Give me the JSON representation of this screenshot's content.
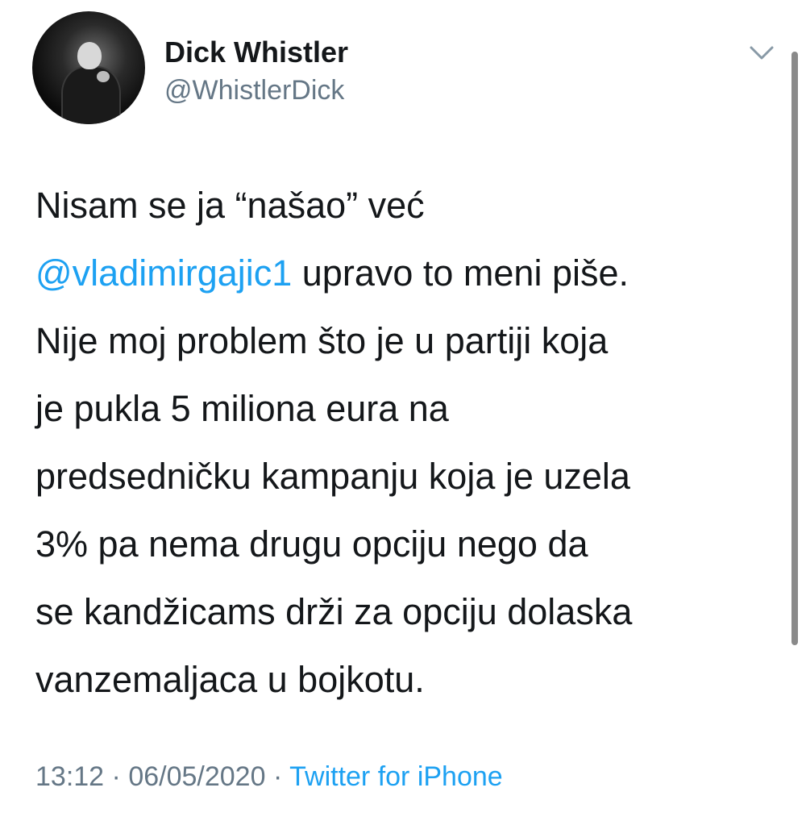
{
  "author": {
    "display_name": "Dick Whistler",
    "handle": "@WhistlerDick"
  },
  "icons": {
    "avatar": "profile-photo",
    "menu": "chevron-down-icon"
  },
  "tweet": {
    "line1": "Nisam se ja “našao” već",
    "mention": "@vladimirgajic1",
    "line2_rest": " upravo to meni piše.",
    "line3": "Nije moj problem što je u partiji koja",
    "line4": "je pukla 5 miliona eura na",
    "line5": "predsedničku kampanju koja je uzela",
    "line6": "3% pa nema drugu opciju nego da",
    "line7": "se kandžicams drži za opciju dolaska",
    "line8": "vanzemaljaca u bojkotu."
  },
  "meta": {
    "time": "13:12",
    "separator": "·",
    "date": "06/05/2020",
    "source": "Twitter for iPhone"
  },
  "colors": {
    "link": "#1da1f2",
    "secondary_text": "#657786",
    "primary_text": "#14171a"
  }
}
